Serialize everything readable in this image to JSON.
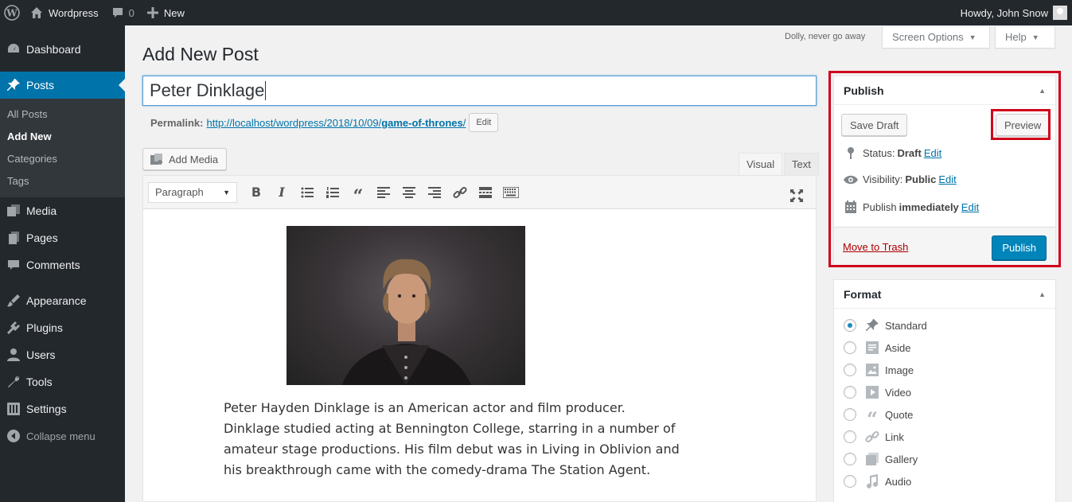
{
  "adminbar": {
    "site_name": "Wordpress",
    "comments_count": "0",
    "new_label": "New",
    "greeting": "Howdy, John Snow"
  },
  "sidebar": {
    "items": [
      {
        "label": "Dashboard",
        "icon": "dashboard-icon"
      },
      {
        "label": "Posts",
        "icon": "pin-icon"
      },
      {
        "label": "Media",
        "icon": "media-icon"
      },
      {
        "label": "Pages",
        "icon": "pages-icon"
      },
      {
        "label": "Comments",
        "icon": "comments-icon"
      },
      {
        "label": "Appearance",
        "icon": "appearance-icon"
      },
      {
        "label": "Plugins",
        "icon": "plugins-icon"
      },
      {
        "label": "Users",
        "icon": "users-icon"
      },
      {
        "label": "Tools",
        "icon": "tools-icon"
      },
      {
        "label": "Settings",
        "icon": "settings-icon"
      },
      {
        "label": "Collapse menu",
        "icon": "collapse-icon"
      }
    ],
    "submenu": [
      "All Posts",
      "Add New",
      "Categories",
      "Tags"
    ]
  },
  "screen_meta": {
    "dolly": "Dolly, never go away",
    "screen_options": "Screen Options",
    "help": "Help"
  },
  "page": {
    "title": "Add New Post",
    "post_title": "Peter Dinklage",
    "permalink_label": "Permalink:",
    "permalink_url": "http://localhost/wordpress/2018/10/09/",
    "permalink_slug": "game-of-thrones",
    "permalink_end": "/",
    "permalink_edit": "Edit"
  },
  "editor": {
    "add_media": "Add Media",
    "tab_visual": "Visual",
    "tab_text": "Text",
    "format_select": "Paragraph",
    "body_text": "Peter Hayden Dinklage is an American actor and film producer. Dinklage studied acting at Bennington College, starring in a number of amateur stage productions. His film debut was in Living in Oblivion and his breakthrough came with the comedy-drama The Station Agent."
  },
  "publish": {
    "title": "Publish",
    "save_draft": "Save Draft",
    "preview": "Preview",
    "status_label": "Status:",
    "status_value": "Draft",
    "visibility_label": "Visibility:",
    "visibility_value": "Public",
    "publish_label": "Publish",
    "publish_value": "immediately",
    "edit": "Edit",
    "move_to_trash": "Move to Trash",
    "publish_button": "Publish"
  },
  "format": {
    "title": "Format",
    "options": [
      "Standard",
      "Aside",
      "Image",
      "Video",
      "Quote",
      "Link",
      "Gallery",
      "Audio"
    ],
    "selected": "Standard"
  },
  "colors": {
    "accent": "#0073aa",
    "highlight": "#d0021b",
    "sidebar_bg": "#23282d"
  }
}
